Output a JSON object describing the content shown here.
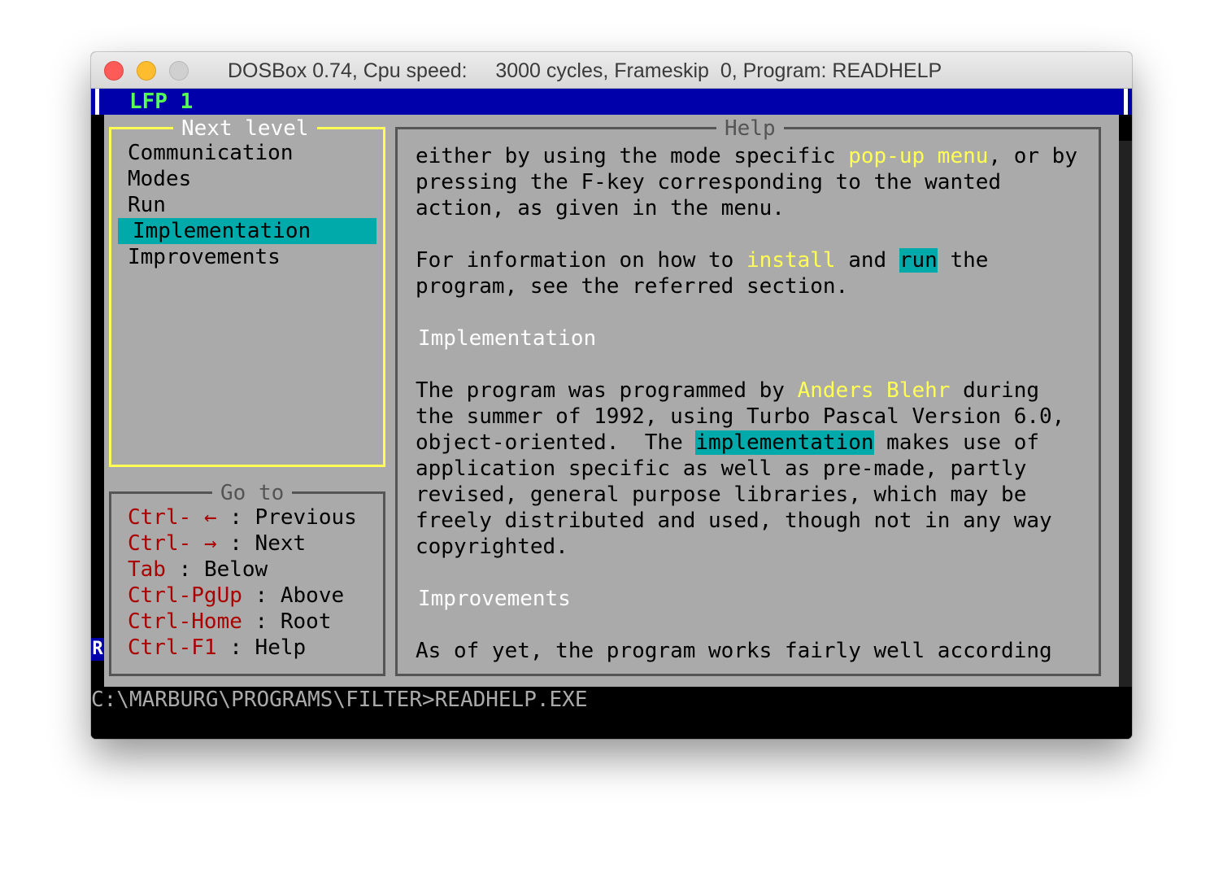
{
  "window": {
    "title": "DOSBox 0.74, Cpu speed:     3000 cycles, Frameskip  0, Program: READHELP"
  },
  "topbar": {
    "label": "LFP 1"
  },
  "nav": {
    "title": "Next level",
    "items": [
      "Communication",
      "Modes",
      "Run",
      "Implementation",
      "Improvements"
    ],
    "selected": "Implementation"
  },
  "help": {
    "title": "Help",
    "lines": [
      {
        "t": "either by using the mode specific "
      },
      {
        "y": "pop-up menu"
      },
      {
        "t": ", or by"
      },
      {
        "t": "pressing the F-key corresponding to the wanted"
      },
      {
        "t": "action, as given in the menu."
      },
      {
        "t": "For information on how to "
      },
      {
        "y": "install"
      },
      {
        "t": " and "
      },
      {
        "c": "run"
      },
      {
        "t": " the"
      },
      {
        "t": "program, see the referred section."
      },
      {
        "h": "Implementation"
      },
      {
        "t": "The program was programmed by "
      },
      {
        "y": "Anders Blehr"
      },
      {
        "t": " during"
      },
      {
        "t": "the summer of 1992, using Turbo Pascal Version 6.0,"
      },
      {
        "t": "object-oriented.  The "
      },
      {
        "c": "implementation"
      },
      {
        "t": " makes use of"
      },
      {
        "t": "application specific as well as pre-made, partly"
      },
      {
        "t": "revised, general purpose libraries, which may be"
      },
      {
        "t": "freely distributed and used, though not in any way"
      },
      {
        "t": "copyrighted."
      },
      {
        "h": "Improvements"
      },
      {
        "t": "As of yet, the program works fairly well according"
      }
    ]
  },
  "goto": {
    "title": "Go to",
    "entries": [
      {
        "key": "Ctrl- ←",
        "sep": " : ",
        "action": "Previous"
      },
      {
        "key": "Ctrl- →",
        "sep": " : ",
        "action": "Next"
      },
      {
        "key": "Tab",
        "sep": " : ",
        "action": "Below"
      },
      {
        "key": "Ctrl-PgUp",
        "sep": " : ",
        "action": "Above"
      },
      {
        "key": "Ctrl-Home",
        "sep": " : ",
        "action": "Root"
      },
      {
        "key": "Ctrl-F1",
        "sep": " : ",
        "action": "Help"
      }
    ]
  },
  "prompt": {
    "text": "C:\\MARBURG\\PROGRAMS\\FILTER>READHELP.EXE"
  },
  "colors": {
    "dos_blue": "#0000aa",
    "dos_gray": "#aaaaaa",
    "dos_cyan": "#00aaaa",
    "dos_yellow": "#ffff55",
    "dos_red": "#aa0000",
    "dos_green": "#55ff55"
  }
}
